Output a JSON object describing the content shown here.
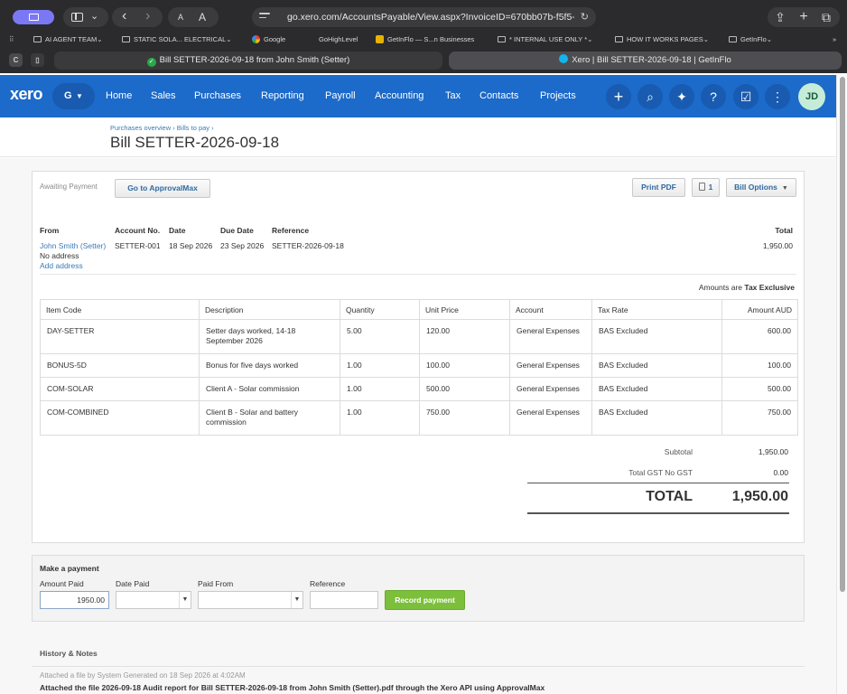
{
  "browser": {
    "url": "go.xero.com/AccountsPayable/View.aspx?InvoiceID=670bb07b-f5f5-40",
    "font_small": "A",
    "font_large": "A",
    "bookmarks": [
      {
        "label": "AI AGENT TEAM",
        "icon": "folder-icon",
        "chevron": true
      },
      {
        "label": "STATIC SOLA... ELECTRICAL",
        "icon": "folder-icon",
        "chevron": true
      },
      {
        "label": "Google",
        "icon": "google-icon",
        "chevron": false
      },
      {
        "label": "GoHighLevel",
        "icon": "none",
        "chevron": false
      },
      {
        "label": "GetInFlo — S...n Businesses",
        "icon": "getinflo-icon",
        "chevron": false
      },
      {
        "label": "* INTERNAL USE ONLY *",
        "icon": "folder-icon",
        "chevron": true
      },
      {
        "label": "HOW IT WORKS PAGES",
        "icon": "folder-icon",
        "chevron": true
      },
      {
        "label": "GetInFlo",
        "icon": "folder-icon",
        "chevron": true
      }
    ],
    "tab_inactive": "Bill SETTER-2026-09-18 from John Smith (Setter)",
    "tab_active": "Xero | Bill SETTER-2026-09-18 | GetInFlo",
    "tab_group_badge": "C"
  },
  "nav": {
    "logo": "xero",
    "org": "G",
    "items": [
      "Home",
      "Sales",
      "Purchases",
      "Reporting",
      "Payroll",
      "Accounting",
      "Tax",
      "Contacts",
      "Projects"
    ],
    "avatar": "JD",
    "brand_color": "#1c6ac9"
  },
  "page": {
    "breadcrumb": "Purchases overview › Bills to pay ›",
    "title": "Bill SETTER-2026-09-18"
  },
  "bill": {
    "status": "Awaiting Payment",
    "approval_btn": "Go to ApprovalMax",
    "print_btn": "Print PDF",
    "copies_count": "1",
    "options_btn": "Bill Options",
    "headers": {
      "from": "From",
      "account_no": "Account No.",
      "date": "Date",
      "due_date": "Due Date",
      "reference": "Reference",
      "total": "Total"
    },
    "from_name": "John Smith (Setter)",
    "no_address": "No address",
    "add_address": "Add address",
    "account_no": "SETTER-001",
    "date": "18 Sep 2026",
    "due_date": "23 Sep 2026",
    "reference": "SETTER-2026-09-18",
    "total": "1,950.00",
    "amounts_label": "Amounts are",
    "amounts_mode": "Tax Exclusive",
    "columns": [
      "Item Code",
      "Description",
      "Quantity",
      "Unit Price",
      "Account",
      "Tax Rate",
      "Amount AUD"
    ],
    "lines": [
      {
        "code": "DAY-SETTER",
        "desc": "Setter days worked, 14-18 September 2026",
        "qty": "5.00",
        "price": "120.00",
        "account": "General Expenses",
        "tax": "BAS Excluded",
        "amount": "600.00"
      },
      {
        "code": "BONUS-5D",
        "desc": "Bonus for five days worked",
        "qty": "1.00",
        "price": "100.00",
        "account": "General Expenses",
        "tax": "BAS Excluded",
        "amount": "100.00"
      },
      {
        "code": "COM-SOLAR",
        "desc": "Client A - Solar commission",
        "qty": "1.00",
        "price": "500.00",
        "account": "General Expenses",
        "tax": "BAS Excluded",
        "amount": "500.00"
      },
      {
        "code": "COM-COMBINED",
        "desc": "Client B - Solar and battery commission",
        "qty": "1.00",
        "price": "750.00",
        "account": "General Expenses",
        "tax": "BAS Excluded",
        "amount": "750.00"
      }
    ],
    "subtotal_label": "Subtotal",
    "subtotal": "1,950.00",
    "gst_label": "Total GST  No GST",
    "gst": "0.00",
    "total_label": "TOTAL",
    "total_value": "1,950.00"
  },
  "payment": {
    "title": "Make a payment",
    "amount_label": "Amount Paid",
    "amount_value": "1950.00",
    "date_label": "Date Paid",
    "from_label": "Paid From",
    "reference_label": "Reference",
    "record_btn": "Record payment",
    "record_color": "#7cbf3a"
  },
  "history": {
    "title": "History & Notes",
    "line1": "Attached a file by System Generated on 18 Sep 2026 at 4:02AM",
    "line2": "Attached the file 2026-09-18 Audit report for Bill SETTER-2026-09-18 from John Smith (Setter).pdf through the Xero API using ApprovalMax"
  }
}
